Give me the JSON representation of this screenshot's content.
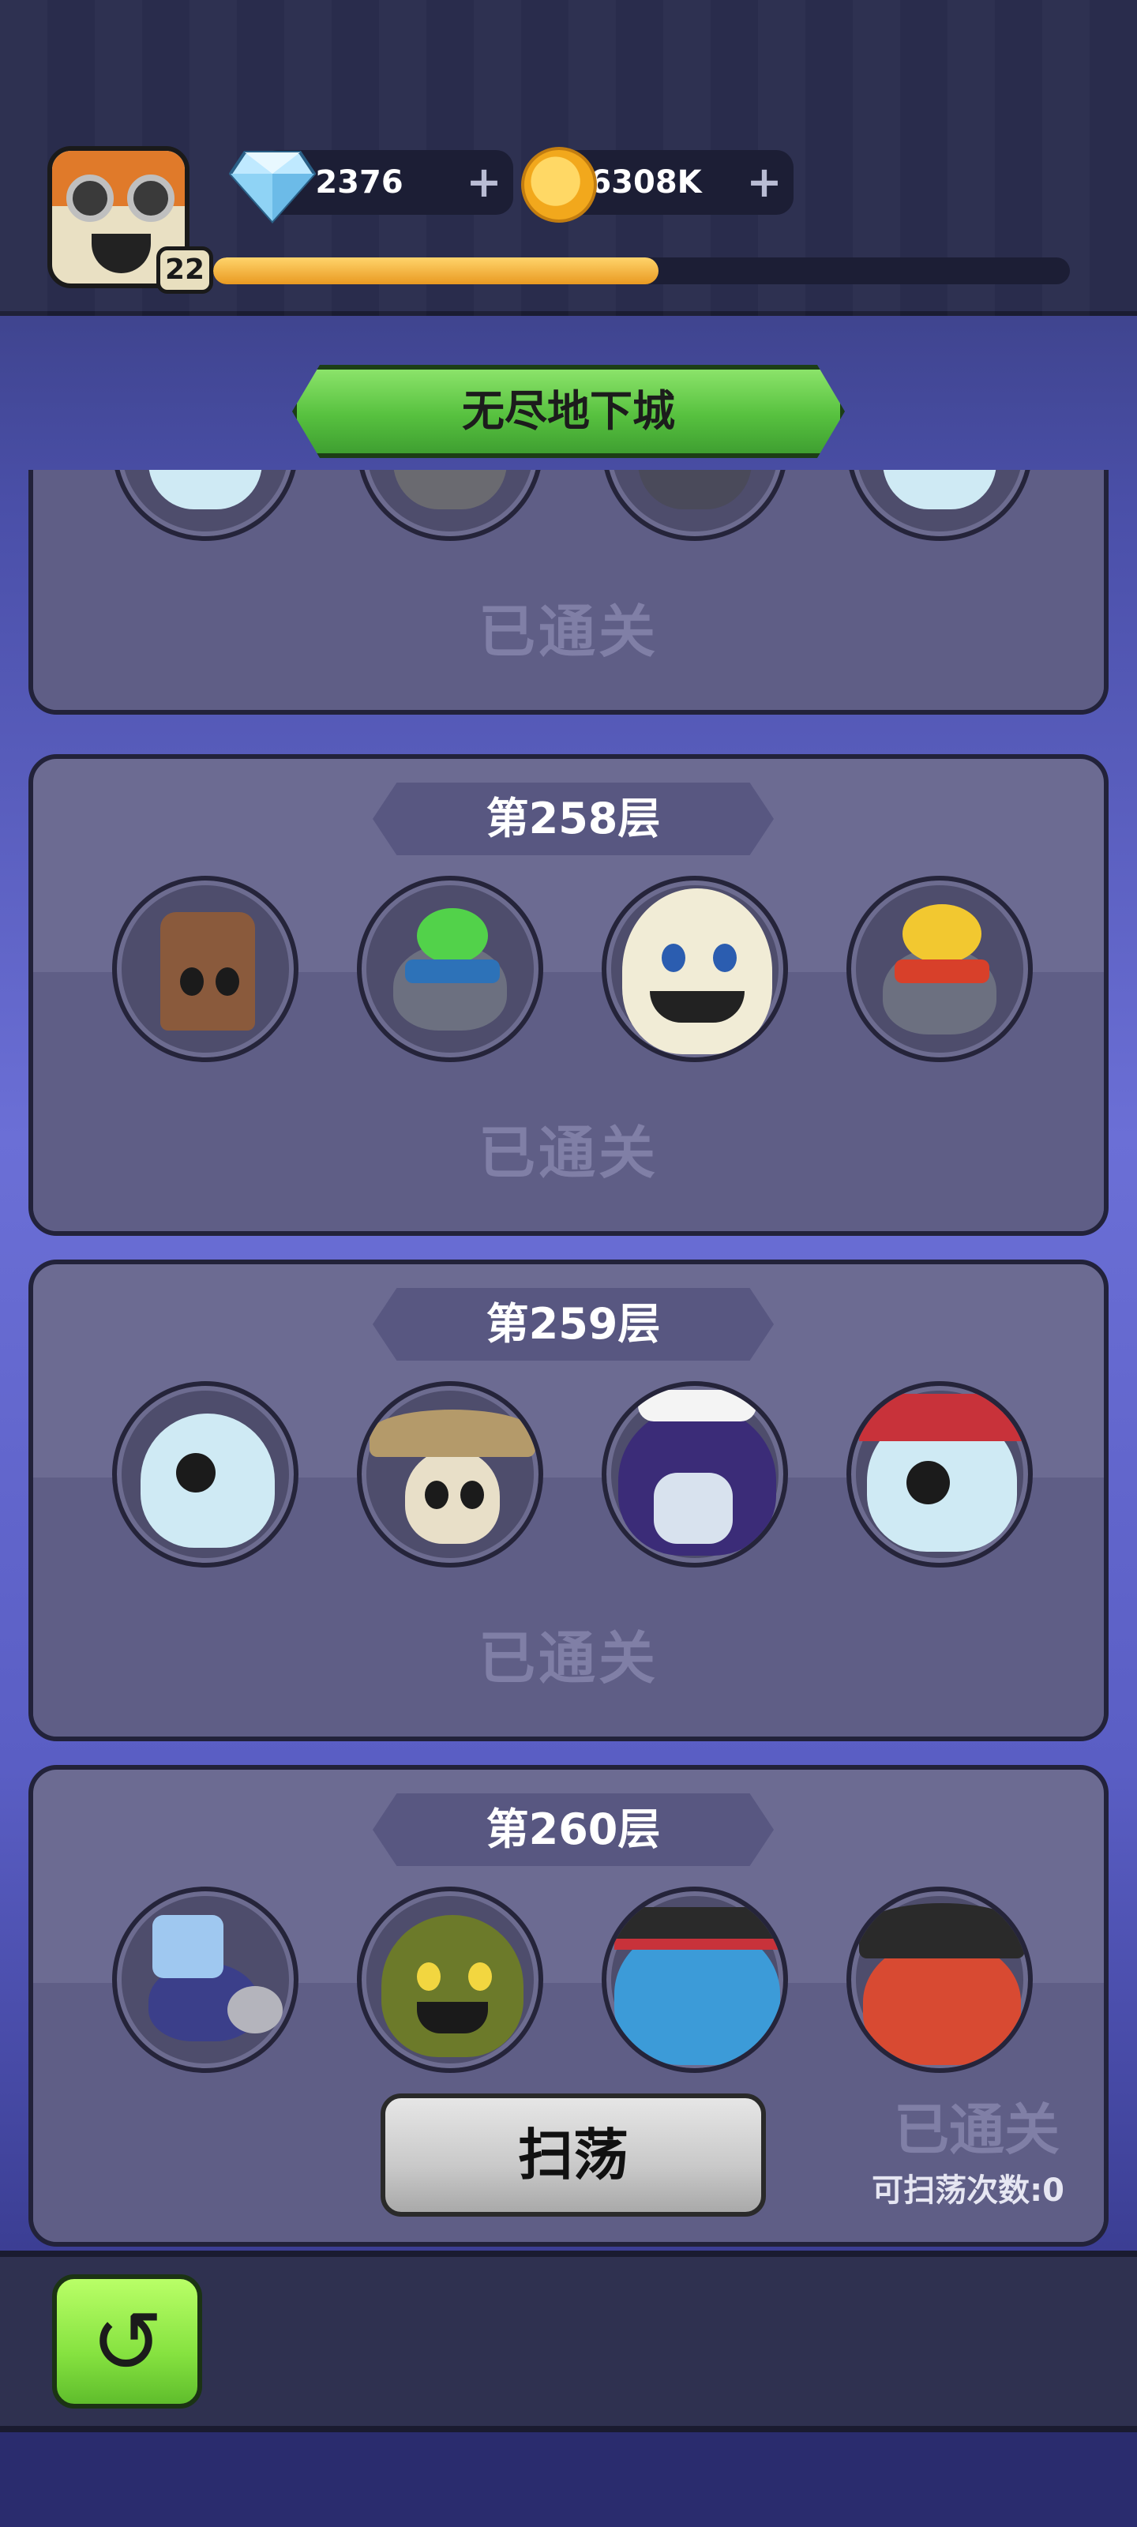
{
  "player": {
    "level": "22",
    "xp_progress": 0.52
  },
  "currency": {
    "gems": "2376",
    "coins": "6308K",
    "plus": "+"
  },
  "title": "无尽地下城",
  "floors": [
    {
      "label": "",
      "status": "已通关"
    },
    {
      "label": "第258层",
      "status": "已通关"
    },
    {
      "label": "第259层",
      "status": "已通关"
    },
    {
      "label": "第260层",
      "status": "已通关",
      "sweep_label": "扫荡",
      "sweep_count": "可扫荡次数:0"
    }
  ],
  "back_icon": "↺",
  "colors": {
    "banner": "#57c13f",
    "card": "#6c6b92",
    "xp": "#f0b13a"
  }
}
